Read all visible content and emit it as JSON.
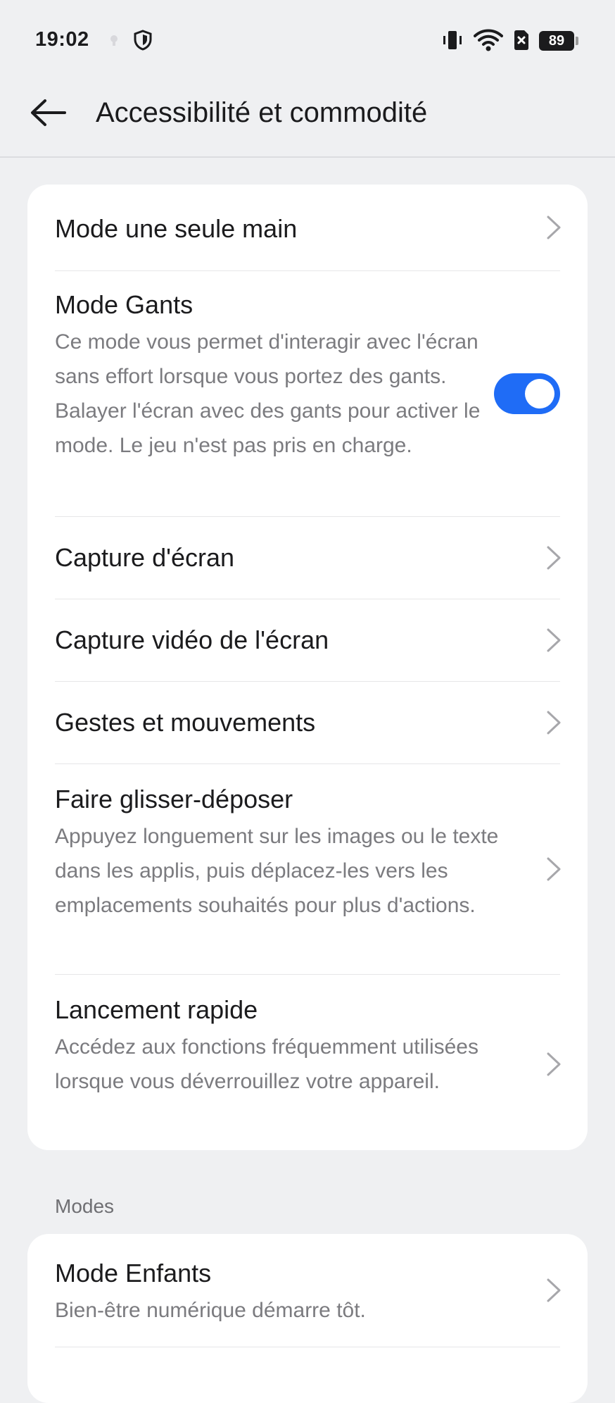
{
  "status_bar": {
    "time": "19:02",
    "icons": [
      "notification-dot-icon",
      "shield-icon",
      "vibrate-icon",
      "wifi-icon",
      "sim-x-icon"
    ],
    "battery": "89"
  },
  "header": {
    "title": "Accessibilité et commodité",
    "back_icon": "arrow-left-icon"
  },
  "card1": {
    "items": [
      {
        "title": "Mode une seule main",
        "desc": ""
      },
      {
        "title": "Mode Gants",
        "desc": "Ce mode vous permet d'interagir avec l'écran sans effort lorsque vous portez des gants. Balayer l'écran avec des gants pour activer le mode. Le jeu n'est pas pris en charge.",
        "toggle_on": true
      },
      {
        "title": "Capture d'écran",
        "desc": ""
      },
      {
        "title": "Capture vidéo de l'écran",
        "desc": ""
      },
      {
        "title": "Gestes et mouvements",
        "desc": ""
      },
      {
        "title": "Faire glisser-déposer",
        "desc": "Appuyez longuement sur les images ou le texte dans les applis, puis déplacez-les vers les emplacements souhaités pour plus d'actions."
      },
      {
        "title": "Lancement rapide",
        "desc": "Accédez aux fonctions fréquemment utilisées lorsque vous déverrouillez votre appareil."
      }
    ]
  },
  "modes": {
    "header": "Modes",
    "items": [
      {
        "title": "Mode Enfants",
        "desc": "Bien-être numérique démarre tôt."
      }
    ]
  },
  "colors": {
    "background": "#eff0f2",
    "card": "#ffffff",
    "accent": "#1f6cf6",
    "secondary_text": "#7b7b7f"
  }
}
